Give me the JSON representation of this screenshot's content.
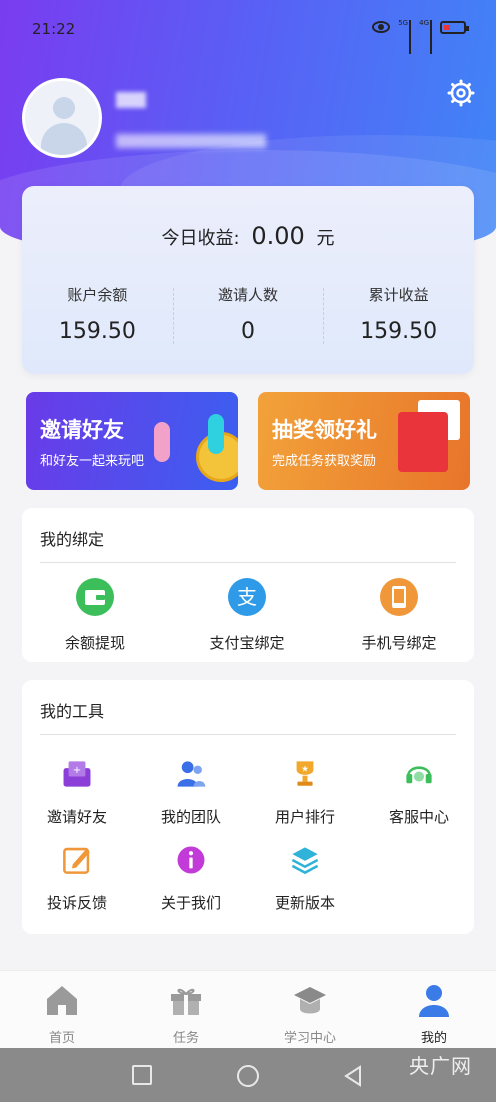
{
  "status_bar": {
    "time": "21:22",
    "sig1_label": "5G",
    "sig2_label": "4G"
  },
  "profile": {
    "avatar": "avatar-placeholder"
  },
  "earnings": {
    "today_label": "今日收益:",
    "today_value": "0.00",
    "today_unit": "元",
    "stats": [
      {
        "label": "账户余额",
        "value": "159.50"
      },
      {
        "label": "邀请人数",
        "value": "0"
      },
      {
        "label": "累计收益",
        "value": "159.50"
      }
    ]
  },
  "banners": {
    "invite": {
      "title": "邀请好友",
      "subtitle": "和好友一起来玩吧"
    },
    "lottery": {
      "title": "抽奖领好礼",
      "subtitle": "完成任务获取奖励"
    }
  },
  "binding": {
    "title": "我的绑定",
    "items": [
      {
        "label": "余额提现",
        "icon": "wallet-icon",
        "color": "#3cbf5a"
      },
      {
        "label": "支付宝绑定",
        "icon": "alipay-icon",
        "color": "#2f9be8"
      },
      {
        "label": "手机号绑定",
        "icon": "phone-icon",
        "color": "#f0973a"
      }
    ]
  },
  "tools": {
    "title": "我的工具",
    "items": [
      {
        "label": "邀请好友",
        "icon": "invite-icon",
        "color": "#8b3fd8"
      },
      {
        "label": "我的团队",
        "icon": "team-icon",
        "color": "#3a6fe8"
      },
      {
        "label": "用户排行",
        "icon": "trophy-icon",
        "color": "#f2a82c"
      },
      {
        "label": "客服中心",
        "icon": "headset-icon",
        "color": "#3cbf5a"
      },
      {
        "label": "投诉反馈",
        "icon": "edit-icon",
        "color": "#f0973a"
      },
      {
        "label": "关于我们",
        "icon": "info-icon",
        "color": "#c23ad8"
      },
      {
        "label": "更新版本",
        "icon": "layers-icon",
        "color": "#2fb3d8"
      }
    ]
  },
  "tabbar": [
    {
      "label": "首页",
      "icon": "home-icon"
    },
    {
      "label": "任务",
      "icon": "gift-icon"
    },
    {
      "label": "学习中心",
      "icon": "graduation-cap-icon"
    },
    {
      "label": "我的",
      "icon": "user-icon",
      "active": true
    }
  ],
  "watermark": "央广网"
}
